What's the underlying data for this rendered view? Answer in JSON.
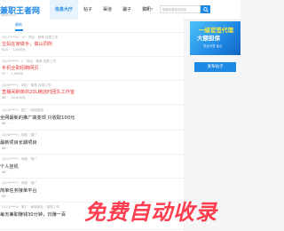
{
  "header": {
    "logo": "兼职王者网",
    "logo_sub": "jianzhi.com",
    "nav": [
      "信息大厅",
      "帖子",
      "渠道",
      "骗子",
      "资讯",
      "APP下载"
    ],
    "region": "全部",
    "search_placeholder": "搜索你要找的信息",
    "search_icon": "search-icon"
  },
  "tabs": [
    "最新"
  ],
  "items": [
    {
      "meta": "QQ:7****6  ·  10  ·  项目  ·  推荐 找零工作",
      "title": "宝妈在家做手，做山同所",
      "title_red": true,
      "info": "¥10  ·  ·  1,000元"
    },
    {
      "meta": "QQ:5****9  ·  2  ·  项目  ·  推荐 找零工作",
      "title": "手机全职招聘网页",
      "title_red": true,
      "info": "¥7  ·  ·  1,000元"
    },
    {
      "meta": "QQ:8****1  ·  项目  ·  推荐 找零工作",
      "title": "直播间刷单的20L精选时团队工作室",
      "title_red": true,
      "info": "¥8  ·  ·  20,000元"
    },
    {
      "meta": "QQ:4****2  ·  推广  ·  网络推荐",
      "title": "全网最新的推广高变现 只收取100元",
      "title_red": false,
      "info": "¥8  ·  ·  ·"
    },
    {
      "meta": "QQ:6****3  ·  网络  ·  推广",
      "title": "最新项目长期项目",
      "title_red": false,
      "info": "¥8  ·  ·  ·"
    },
    {
      "meta": "QQ:2****0  ·  网络  ·  推广",
      "title": "个人挂机",
      "title_red": false,
      "info": "¥8  ·  ·"
    },
    {
      "meta": "QQ:9****7  ·  网络  ·  推广",
      "title": "简单任务接单平台",
      "title_red": false,
      "info": "¥8  ·  ·"
    },
    {
      "meta": "QQ:3****8  ·  推广  ·  刷单副业  ·  推荐工作",
      "title": "每天兼职赚钱30分钟，日赚一百",
      "title_red": false,
      "info": ""
    }
  ],
  "sidebar": {
    "banner_line1": "一级官签代理",
    "banner_line2": "大额担保",
    "banner_line3": "安全可靠 省心",
    "publish_label": "发布帖子"
  },
  "watermark": "免费自动收录",
  "colors": {
    "accent": "#1e88e5",
    "red": "#e53935"
  }
}
